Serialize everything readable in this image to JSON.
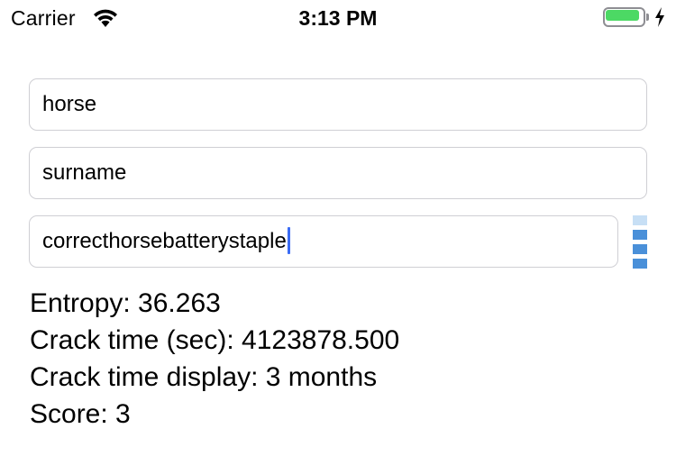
{
  "status_bar": {
    "carrier": "Carrier",
    "time": "3:13 PM",
    "wifi_icon": "wifi-icon",
    "battery_icon": "battery-icon",
    "charging_icon": "charging-bolt-icon",
    "battery_color": "#4cd964"
  },
  "form": {
    "user_input": "horse",
    "second_input": "surname",
    "password_input": "correcthorsebatterystaple"
  },
  "strength_meter": {
    "filled_segments": 3,
    "total_segments": 4,
    "filled_color": "#4a90d9",
    "empty_color": "#c7dff5"
  },
  "results": {
    "entropy": "Entropy: 36.263",
    "crack_time_sec": "Crack time (sec): 4123878.500",
    "crack_time_display": "Crack time display: 3 months",
    "score": "Score: 3"
  }
}
